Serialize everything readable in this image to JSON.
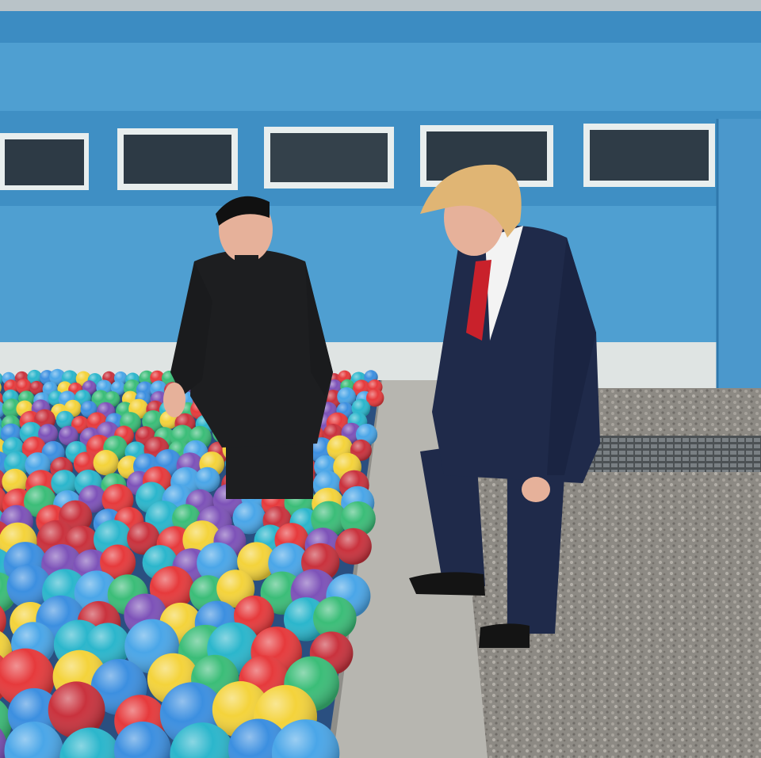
{
  "scene": {
    "kind": "photograph",
    "colors": {
      "wall": "#4f9fd1",
      "wall_dark": "#2f78ad",
      "wall_base": "#dfe4e3",
      "roof": "#b9c3c8",
      "window_frame": "#e8eeee",
      "window_glass": "#2d3a45",
      "ledge": "#b7b6b0",
      "gravel": "#8d8a84",
      "grate": "#5e6366",
      "suit_black": "#1d1e20",
      "suit_navy": "#1f2a4a",
      "tie_red": "#c9212b",
      "hair_blond": "#e0b574",
      "skin": "#e6b19a"
    },
    "ball_colors": [
      "#e63a3c",
      "#2bb6cc",
      "#f4d33b",
      "#3c8fe0",
      "#7d52b8",
      "#3bbd78",
      "#c9323d",
      "#4aa6e8"
    ]
  }
}
